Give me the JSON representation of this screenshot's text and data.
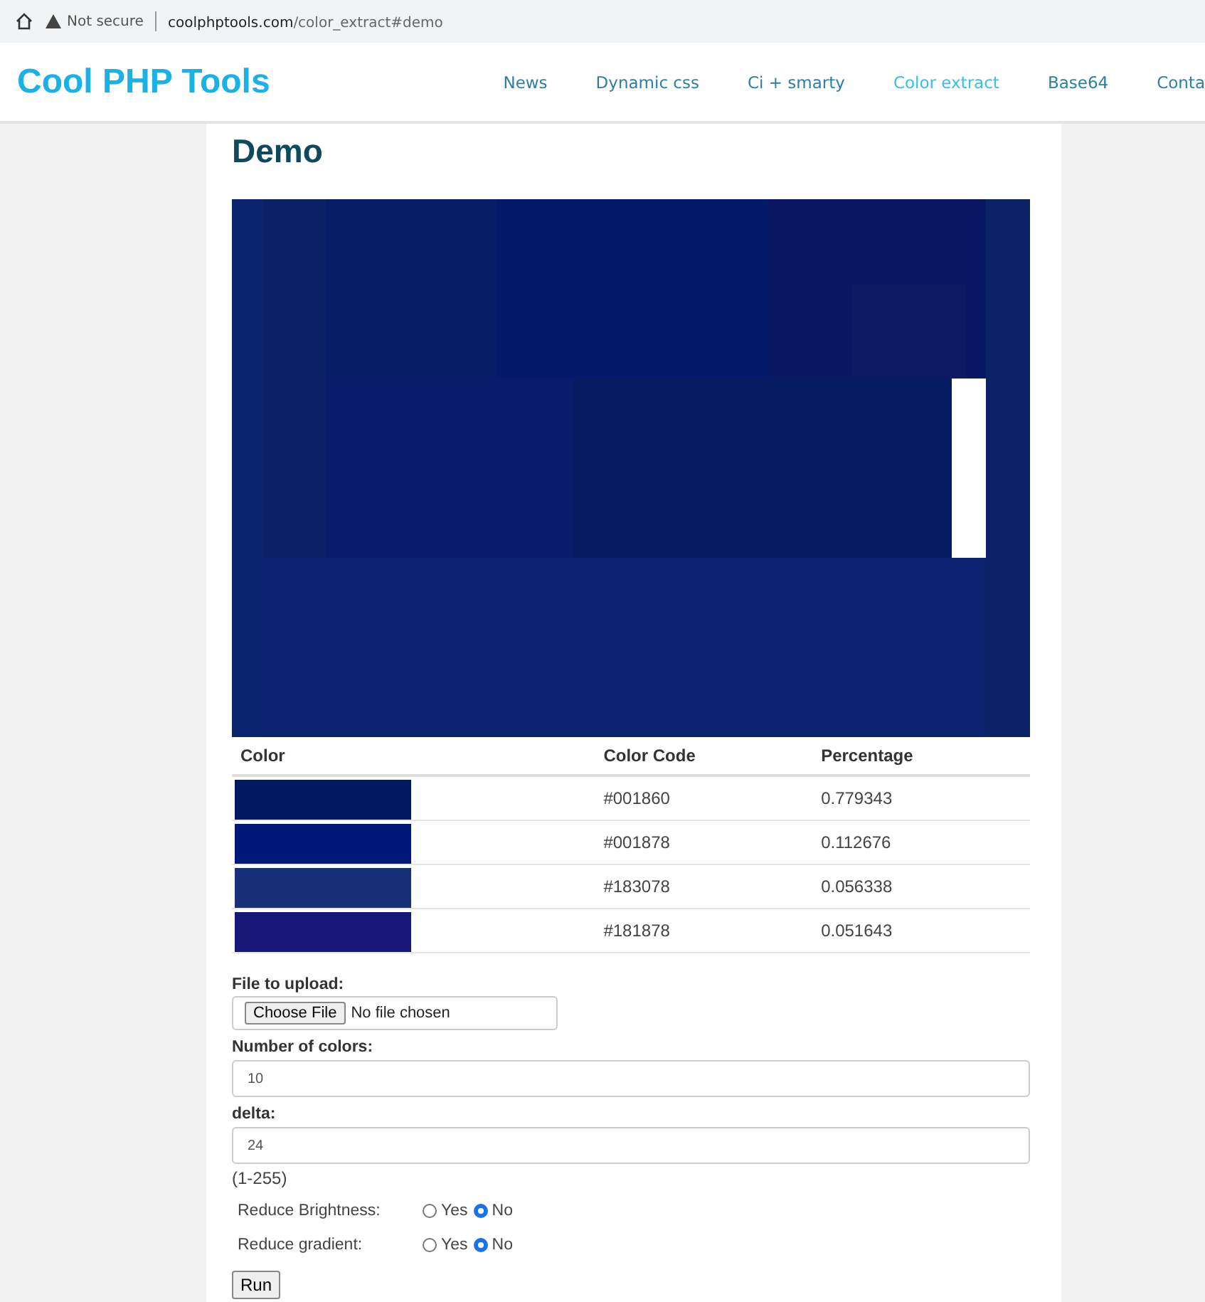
{
  "browser": {
    "security": "Not secure",
    "url_domain": "coolphptools.com",
    "url_path": "/color_extract#demo"
  },
  "site": {
    "logo": "Cool PHP Tools",
    "nav": [
      {
        "label": "News",
        "selected": false
      },
      {
        "label": "Dynamic css",
        "selected": false
      },
      {
        "label": "Ci + smarty",
        "selected": false
      },
      {
        "label": "Color extract",
        "selected": true
      },
      {
        "label": "Base64",
        "selected": false
      },
      {
        "label": "Conta",
        "selected": false
      }
    ]
  },
  "heading": "Demo",
  "table": {
    "columns": [
      "Color",
      "Color Code",
      "Percentage"
    ],
    "rows": [
      {
        "color": "#001860",
        "code": "#001860",
        "percentage": "0.779343"
      },
      {
        "color": "#001878",
        "code": "#001878",
        "percentage": "0.112676"
      },
      {
        "color": "#183078",
        "code": "#183078",
        "percentage": "0.056338"
      },
      {
        "color": "#181878",
        "code": "#181878",
        "percentage": "0.051643"
      }
    ]
  },
  "form": {
    "file": {
      "label": "File to upload:",
      "button": "Choose File",
      "status": "No file chosen"
    },
    "colors": {
      "label": "Number of colors:",
      "value": "10"
    },
    "delta": {
      "label": "delta:",
      "value": "24",
      "hint": "(1-255)"
    },
    "options": [
      {
        "label": "Reduce Brightness:",
        "choices": [
          {
            "label": "Yes",
            "selected": false
          },
          {
            "label": "No",
            "selected": true
          }
        ]
      },
      {
        "label": "Reduce gradient:",
        "choices": [
          {
            "label": "Yes",
            "selected": false
          },
          {
            "label": "No",
            "selected": true
          }
        ]
      }
    ],
    "submit": "Run"
  }
}
